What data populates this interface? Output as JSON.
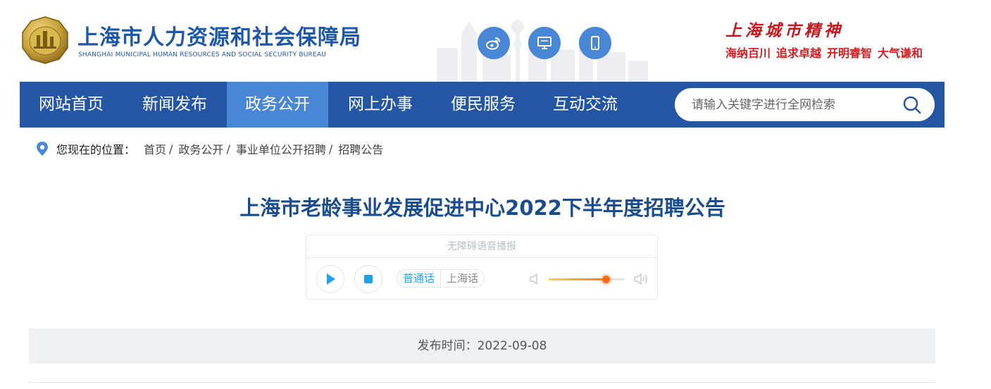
{
  "header": {
    "title": "上海市人力资源和社会保障局",
    "subtitle": "SHANGHAI MUNICIPAL HUMAN RESOURCES AND SOCIAL SECURITY BUREAU",
    "spirit_title": "上海城市精神",
    "spirit_phrases": [
      "海纳百川",
      "追求卓越",
      "开明睿智",
      "大气谦和"
    ],
    "social_icons": [
      "weibo-icon",
      "desktop-icon",
      "mobile-icon"
    ]
  },
  "nav": {
    "items": [
      "网站首页",
      "新闻发布",
      "政务公开",
      "网上办事",
      "便民服务",
      "互动交流"
    ],
    "active_index": 2,
    "search_placeholder": "请输入关键字进行全网检索"
  },
  "breadcrumb": {
    "label": "您现在的位置：",
    "items": [
      "首页",
      "政务公开",
      "事业单位公开招聘",
      "招聘公告"
    ],
    "separator": "/"
  },
  "article": {
    "title": "上海市老龄事业发展促进中心2022下半年度招聘公告",
    "publish_label": "发布时间：2022-09-08"
  },
  "player": {
    "header": "无障碍语音播报",
    "dialects": [
      "普通话",
      "上海话"
    ],
    "selected_dialect": "普通话",
    "volume": 0.75
  },
  "colors": {
    "nav_bg": "#2456a3",
    "nav_active": "#4a86d6",
    "title": "#1a4d8f",
    "spirit": "#c8161d"
  }
}
